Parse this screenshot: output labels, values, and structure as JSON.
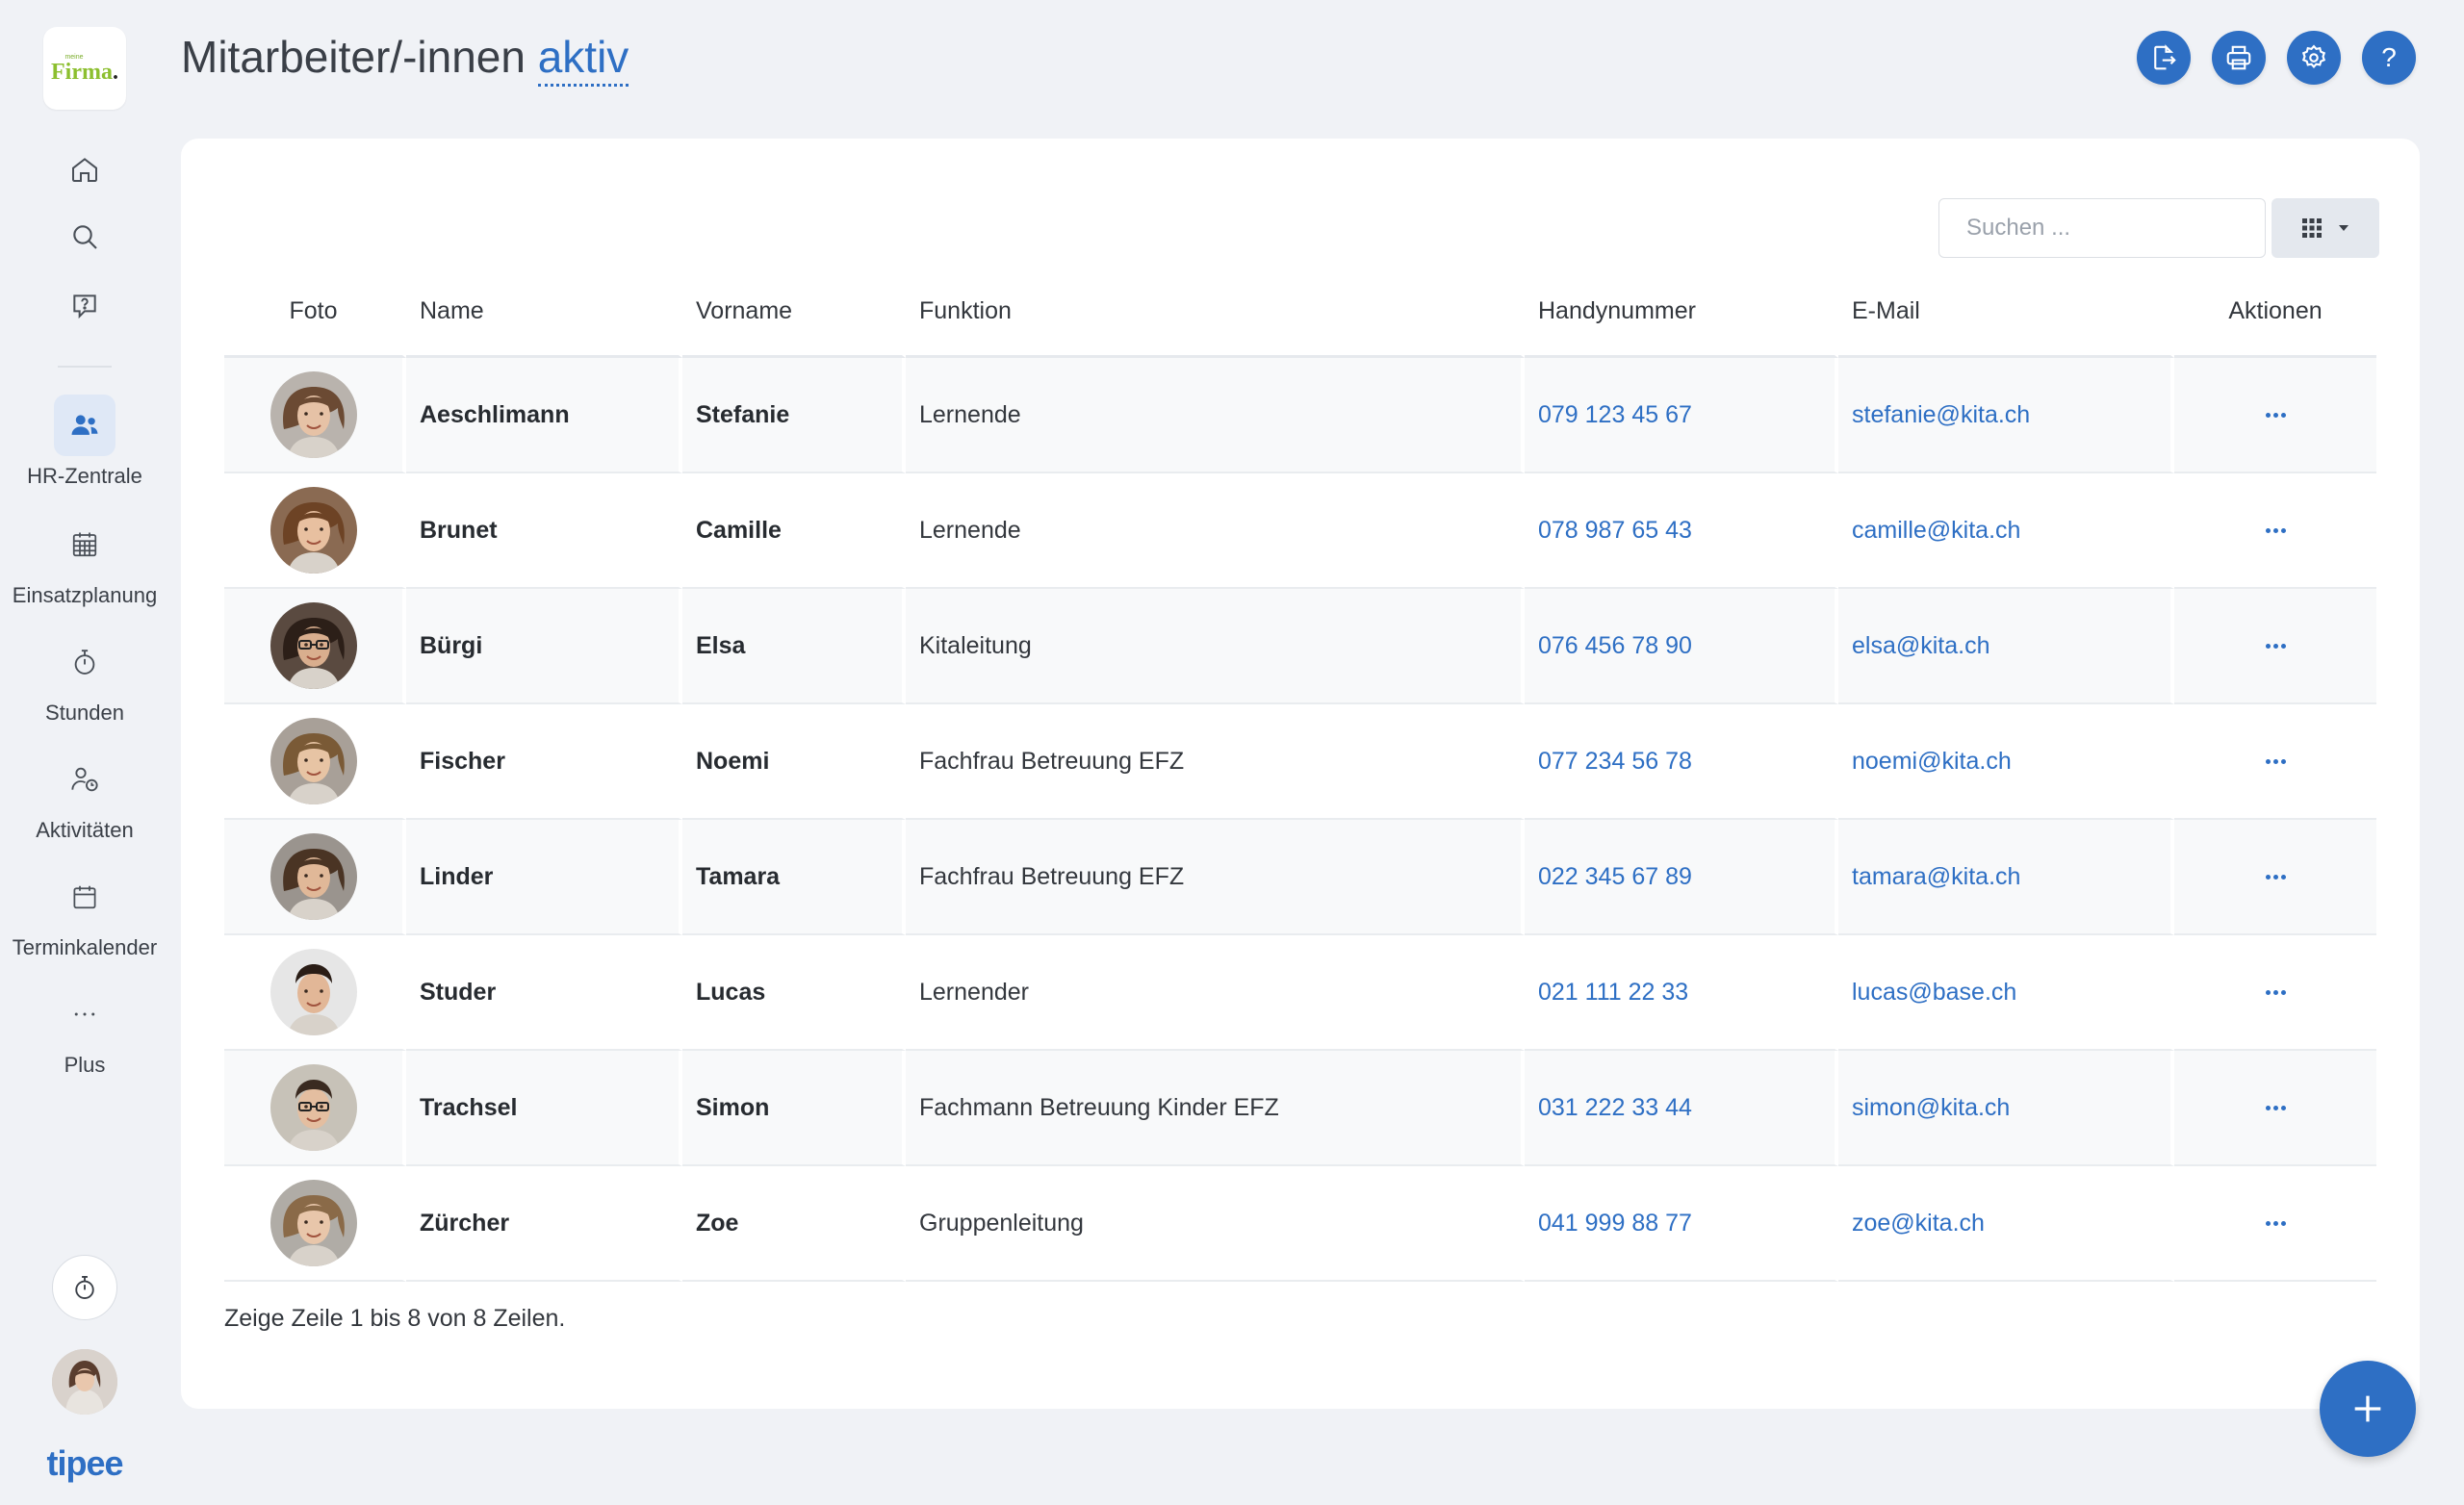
{
  "sidebar": {
    "logo_small": "meine",
    "logo_main": "Firma",
    "logo_dot": ".",
    "top_icons": [
      {
        "icon": "home-icon"
      },
      {
        "icon": "search-icon"
      },
      {
        "icon": "help-chat-icon"
      }
    ],
    "items": [
      {
        "label": "HR-Zentrale",
        "icon": "users-icon",
        "active": true
      },
      {
        "label": "Einsatzplanung",
        "icon": "grid-calendar-icon"
      },
      {
        "label": "Stunden",
        "icon": "stopwatch-icon"
      },
      {
        "label": "Aktivitäten",
        "icon": "user-clock-icon"
      },
      {
        "label": "Terminkalender",
        "icon": "calendar-icon"
      },
      {
        "label": "Plus",
        "icon": "more-dots-icon"
      }
    ],
    "brand": "tipee"
  },
  "header": {
    "title": "Mitarbeiter/-innen",
    "status": "aktiv",
    "buttons": [
      {
        "icon": "export-icon"
      },
      {
        "icon": "print-icon"
      },
      {
        "icon": "settings-icon"
      },
      {
        "icon": "help-icon",
        "text": "?"
      }
    ]
  },
  "toolbar": {
    "search_placeholder": "Suchen ..."
  },
  "table": {
    "columns": [
      "Foto",
      "Name",
      "Vorname",
      "Funktion",
      "Handynummer",
      "E-Mail",
      "Aktionen"
    ],
    "rows": [
      {
        "name": "Aeschlimann",
        "vorname": "Stefanie",
        "funktion": "Lernende",
        "phone": "079 123 45 67",
        "email": "stefanie@kita.ch"
      },
      {
        "name": "Brunet",
        "vorname": "Camille",
        "funktion": "Lernende",
        "phone": "078 987 65 43",
        "email": "camille@kita.ch"
      },
      {
        "name": "Bürgi",
        "vorname": "Elsa",
        "funktion": "Kitaleitung",
        "phone": "076 456 78 90",
        "email": "elsa@kita.ch"
      },
      {
        "name": "Fischer",
        "vorname": "Noemi",
        "funktion": "Fachfrau Betreuung EFZ",
        "phone": "077 234 56 78",
        "email": "noemi@kita.ch"
      },
      {
        "name": "Linder",
        "vorname": "Tamara",
        "funktion": "Fachfrau Betreuung EFZ",
        "phone": "022 345 67 89",
        "email": "tamara@kita.ch"
      },
      {
        "name": "Studer",
        "vorname": "Lucas",
        "funktion": "Lernender",
        "phone": "021 111 22 33",
        "email": "lucas@base.ch"
      },
      {
        "name": "Trachsel",
        "vorname": "Simon",
        "funktion": "Fachmann Betreuung Kinder EFZ",
        "phone": "031 222 33 44",
        "email": "simon@kita.ch"
      },
      {
        "name": "Zürcher",
        "vorname": "Zoe",
        "funktion": "Gruppenleitung",
        "phone": "041 999 88 77",
        "email": "zoe@kita.ch"
      }
    ],
    "footer": "Zeige Zeile 1 bis 8 von 8 Zeilen."
  },
  "colors": {
    "accent": "#2e6fc4",
    "background": "#f0f2f6",
    "logo_green": "#8cbf2f"
  },
  "fab": {
    "icon": "plus-icon"
  }
}
